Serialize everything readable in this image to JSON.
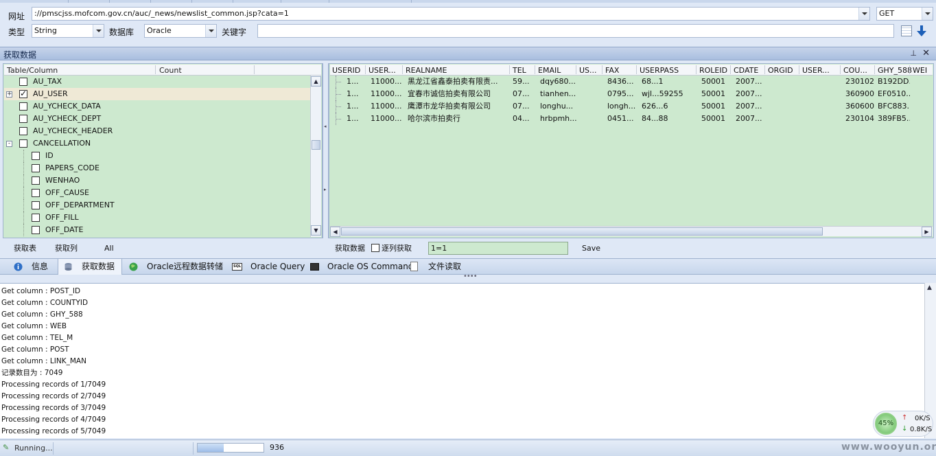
{
  "top": {
    "url_label": "网址",
    "url_value": "://pmscjss.mofcom.gov.cn/auc/_news/newslist_common.jsp?cata=1",
    "method": "GET",
    "type_label": "类型",
    "type_value": "String",
    "db_label": "数据库",
    "db_value": "Oracle",
    "keyword_label": "关键字",
    "keyword_value": ""
  },
  "panel": {
    "title": "获取数据"
  },
  "tree": {
    "headers": [
      "Table/Column",
      "Count"
    ],
    "rows": [
      {
        "name": "AU_TAX",
        "level": 1,
        "checked": false,
        "expander": ""
      },
      {
        "name": "AU_USER",
        "level": 1,
        "checked": true,
        "expander": "+"
      },
      {
        "name": "AU_YCHECK_DATA",
        "level": 1,
        "checked": false,
        "expander": ""
      },
      {
        "name": "AU_YCHECK_DEPT",
        "level": 1,
        "checked": false,
        "expander": ""
      },
      {
        "name": "AU_YCHECK_HEADER",
        "level": 1,
        "checked": false,
        "expander": ""
      },
      {
        "name": "CANCELLATION",
        "level": 1,
        "checked": false,
        "expander": "-"
      },
      {
        "name": "ID",
        "level": 2,
        "checked": false,
        "expander": ""
      },
      {
        "name": "PAPERS_CODE",
        "level": 2,
        "checked": false,
        "expander": ""
      },
      {
        "name": "WENHAO",
        "level": 2,
        "checked": false,
        "expander": ""
      },
      {
        "name": "OFF_CAUSE",
        "level": 2,
        "checked": false,
        "expander": ""
      },
      {
        "name": "OFF_DEPARTMENT",
        "level": 2,
        "checked": false,
        "expander": ""
      },
      {
        "name": "OFF_FILL",
        "level": 2,
        "checked": false,
        "expander": ""
      },
      {
        "name": "OFF_DATE",
        "level": 2,
        "checked": false,
        "expander": ""
      }
    ],
    "selected_index": 1
  },
  "grid": {
    "columns": [
      "USERID",
      "USER...",
      "REALNAME",
      "TEL",
      "EMAIL",
      "US...",
      "FAX",
      "USERPASS",
      "ROLEID",
      "CDATE",
      "ORGID",
      "USER...",
      "COU...",
      "GHY_588",
      "WEI"
    ],
    "rows": [
      [
        "1...",
        "11000...",
        "黑龙江省鑫泰拍卖有限责...",
        "59...",
        "dqy680...",
        "",
        "8436...",
        "68...1",
        "50001",
        "2007...",
        "",
        "",
        "230102",
        "B192DD...",
        ""
      ],
      [
        "1...",
        "11000...",
        "宜春市诚信拍卖有限公司",
        "07...",
        "tianhen...",
        "",
        "0795...",
        "wjl...59255",
        "50001",
        "2007...",
        "",
        "",
        "360900",
        "EF0510...",
        ""
      ],
      [
        "1...",
        "11000...",
        "鹰潭市龙华拍卖有限公司",
        "07...",
        "longhu...",
        "",
        "longh...",
        "626...6",
        "50001",
        "2007...",
        "",
        "",
        "360600",
        "BFC883...",
        ""
      ],
      [
        "1...",
        "11000...",
        "哈尔滨市拍卖行",
        "04...",
        "hrbpmh...",
        "",
        "0451...",
        "84...88",
        "50001",
        "2007...",
        "",
        "",
        "230104",
        "389FB5...",
        ""
      ]
    ]
  },
  "left_actions": {
    "get_table": "获取表",
    "get_column": "获取列",
    "all": "All"
  },
  "right_actions": {
    "get_data": "获取数据",
    "per_column": "逐列获取",
    "condition": "1=1",
    "save": "Save"
  },
  "tabs": [
    {
      "label": "信息",
      "icon": "info-icon",
      "active": false
    },
    {
      "label": "获取数据",
      "icon": "database-icon",
      "active": true
    },
    {
      "label": "Oracle远程数据转储",
      "icon": "globe-icon",
      "active": false
    },
    {
      "label": "Oracle Query",
      "icon": "sql-icon",
      "active": false
    },
    {
      "label": "Oracle OS Command",
      "icon": "terminal-icon",
      "active": false
    },
    {
      "label": "文件读取",
      "icon": "file-icon",
      "active": false
    }
  ],
  "log": [
    "Get column : POST_ID",
    "Get column : COUNTYID",
    "Get column : GHY_588",
    "Get column : WEB",
    "Get column : TEL_M",
    "Get column : POST",
    "Get column : LINK_MAN",
    "记录数目为 : 7049",
    "Processing records of 1/7049",
    "Processing records of 2/7049",
    "Processing records of 3/7049",
    "Processing records of 4/7049",
    "Processing records of 5/7049"
  ],
  "speed": {
    "percent": "45%",
    "up": "0K/S",
    "down": "0.8K/S"
  },
  "status": {
    "running": "Running...",
    "progress_fraction": 0.4,
    "count": "936"
  },
  "watermark": "www.wooyun.org",
  "colors": {
    "panel_green": "#cde9cf",
    "header_blue": "#a9bedf"
  }
}
